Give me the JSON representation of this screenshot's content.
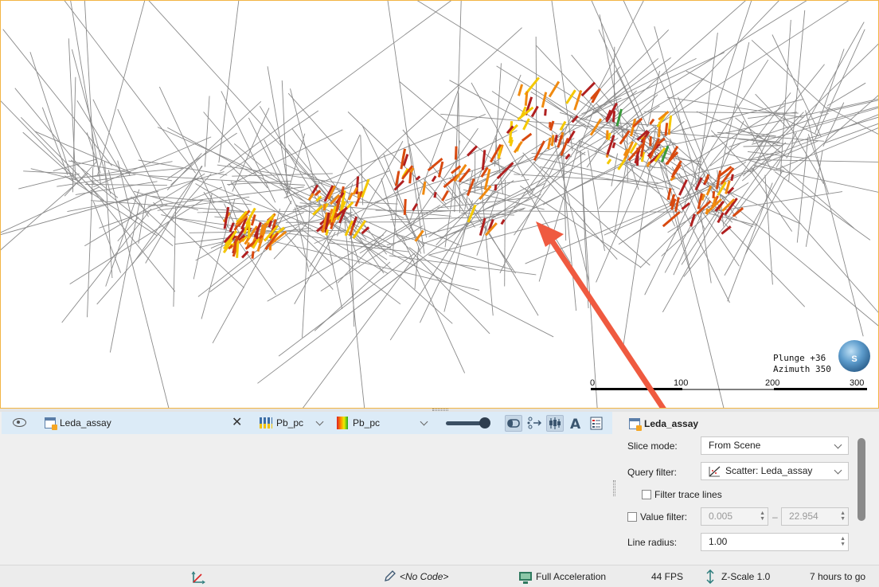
{
  "scene": {
    "plunge_label": "Plunge +36",
    "azimuth_label": "Azimuth 350",
    "compass_letter": "S",
    "scale_ticks": [
      "0",
      "100",
      "200",
      "300"
    ],
    "annotation_arrow_color": "#ef5a40",
    "trace_color": "#8a8a8a",
    "assay_colors": [
      "#f5c800",
      "#f08a10",
      "#d84a10",
      "#b02020",
      "#3a9a3a"
    ]
  },
  "layer": {
    "name": "Leda_assay",
    "column_select": "Pb_pc",
    "colormap_select": "Pb_pc"
  },
  "properties": {
    "title": "Leda_assay",
    "slice_mode_label": "Slice mode:",
    "slice_mode_value": "From Scene",
    "query_filter_label": "Query filter:",
    "query_filter_value": "Scatter: Leda_assay",
    "filter_trace_lines_label": "Filter trace lines",
    "filter_trace_lines_checked": false,
    "value_filter_label": "Value filter:",
    "value_filter_checked": false,
    "value_min": "0.005",
    "value_separator": "–",
    "value_max": "22.954",
    "line_radius_label": "Line radius:",
    "line_radius_value": "1.00"
  },
  "status": {
    "code": "<No Code>",
    "acceleration": "Full Acceleration",
    "fps": "44 FPS",
    "zscale": "Z-Scale 1.0",
    "time_left": "7 hours to go"
  }
}
